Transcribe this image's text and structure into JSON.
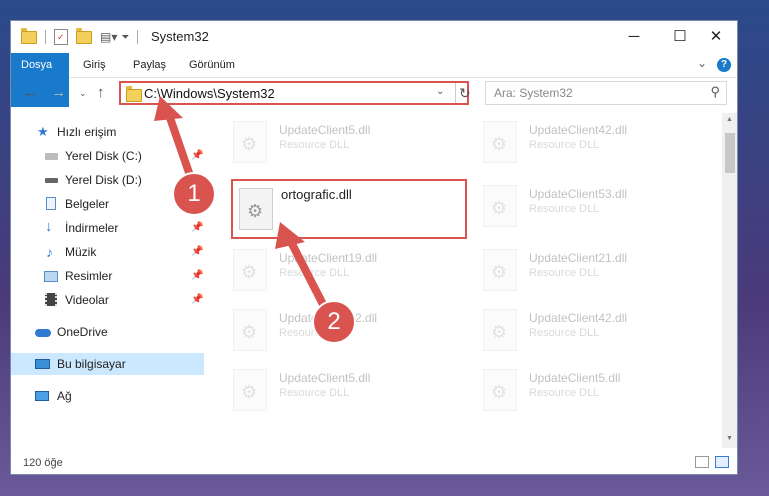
{
  "window": {
    "title": "System32",
    "controls": {
      "minimize": "─",
      "maximize": "☐",
      "close": "✕"
    }
  },
  "ribbon": {
    "tabs": [
      "Dosya",
      "Giriş",
      "Paylaş",
      "Görünüm"
    ],
    "help": "?"
  },
  "address": {
    "path": "C:\\Windows\\System32",
    "search_placeholder": "Ara: System32"
  },
  "sidebar": {
    "items": [
      {
        "label": "Hızlı erişim",
        "icon": "star-icon",
        "pinned": false
      },
      {
        "label": "Yerel Disk (C:)",
        "icon": "drive-icon",
        "pinned": true
      },
      {
        "label": "Yerel Disk (D:)",
        "icon": "drive-icon",
        "pinned": true
      },
      {
        "label": "Belgeler",
        "icon": "documents-icon",
        "pinned": true
      },
      {
        "label": "İndirmeler",
        "icon": "download-icon",
        "pinned": true
      },
      {
        "label": "Müzik",
        "icon": "music-icon",
        "pinned": true
      },
      {
        "label": "Resimler",
        "icon": "pictures-icon",
        "pinned": true
      },
      {
        "label": "Videolar",
        "icon": "video-icon",
        "pinned": true
      },
      {
        "label": "OneDrive",
        "icon": "cloud-icon",
        "pinned": false
      },
      {
        "label": "Bu bilgisayar",
        "icon": "computer-icon",
        "pinned": false,
        "selected": true
      },
      {
        "label": "Ağ",
        "icon": "network-icon",
        "pinned": false
      }
    ]
  },
  "files": {
    "highlighted": {
      "name": "ortografic.dll"
    },
    "items": [
      {
        "name": "UpdateClient5.dll",
        "type": "Resource DLL"
      },
      {
        "name": "UpdateClient42.dll",
        "type": "Resource DLL"
      },
      {
        "name": "UpdateClient53.dll",
        "type": "Resource DLL"
      },
      {
        "name": "UpdateClient19.dll",
        "type": "Resource DLL"
      },
      {
        "name": "UpdateClient21.dll",
        "type": "Resource DLL"
      },
      {
        "name": "UpdateClient42.dll",
        "type": "Resource DLL"
      },
      {
        "name": "UpdateClient42.dll",
        "type": "Resource DLL"
      },
      {
        "name": "UpdateClient5.dll",
        "type": "Resource DLL"
      },
      {
        "name": "UpdateClient5.dll",
        "type": "Resource DLL"
      }
    ]
  },
  "status": {
    "count": "120 öğe"
  },
  "callouts": {
    "step1": "1",
    "step2": "2"
  },
  "colors": {
    "accent": "#1979ca",
    "highlight": "#d9534f",
    "selection": "#cce8ff"
  }
}
